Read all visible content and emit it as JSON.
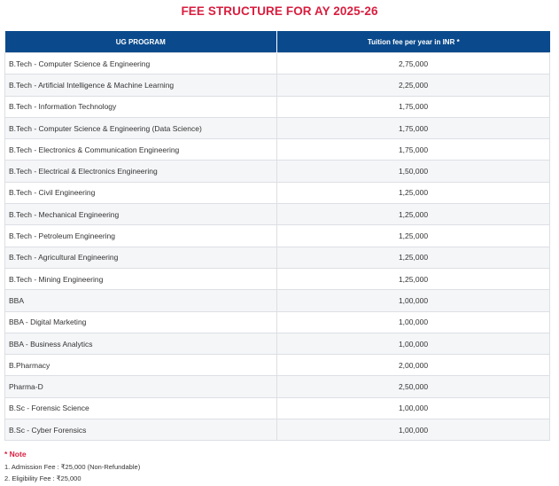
{
  "title": "FEE STRUCTURE FOR AY 2025-26",
  "table": {
    "headers": {
      "program": "UG PROGRAM",
      "fee": "Tuition fee per year in INR *"
    },
    "rows": [
      {
        "program": "B.Tech - Computer Science & Engineering",
        "fee": "2,75,000"
      },
      {
        "program": "B.Tech - Artificial Intelligence & Machine Learning",
        "fee": "2,25,000"
      },
      {
        "program": "B.Tech - Information Technology",
        "fee": "1,75,000"
      },
      {
        "program": "B.Tech - Computer Science & Engineering (Data Science)",
        "fee": "1,75,000"
      },
      {
        "program": "B.Tech - Electronics & Communication Engineering",
        "fee": "1,75,000"
      },
      {
        "program": "B.Tech - Electrical & Electronics Engineering",
        "fee": "1,50,000"
      },
      {
        "program": "B.Tech - Civil Engineering",
        "fee": "1,25,000"
      },
      {
        "program": "B.Tech - Mechanical Engineering",
        "fee": "1,25,000"
      },
      {
        "program": "B.Tech - Petroleum Engineering",
        "fee": "1,25,000"
      },
      {
        "program": "B.Tech - Agricultural Engineering",
        "fee": "1,25,000"
      },
      {
        "program": "B.Tech - Mining Engineering",
        "fee": "1,25,000"
      },
      {
        "program": "BBA",
        "fee": "1,00,000"
      },
      {
        "program": "BBA - Digital Marketing",
        "fee": "1,00,000"
      },
      {
        "program": "BBA - Business Analytics",
        "fee": "1,00,000"
      },
      {
        "program": "B.Pharmacy",
        "fee": "2,00,000"
      },
      {
        "program": "Pharma-D",
        "fee": "2,50,000"
      },
      {
        "program": "B.Sc - Forensic Science",
        "fee": "1,00,000"
      },
      {
        "program": "B.Sc - Cyber Forensics",
        "fee": "1,00,000"
      }
    ]
  },
  "note": {
    "heading": "* Note",
    "lines": [
      "1. Admission Fee : ₹25,000 (Non-Refundable)",
      "2. Eligibility Fee : ₹25,000"
    ]
  },
  "colors": {
    "title": "#d91e3f",
    "header_bg": "#0a4a8c",
    "note_heading": "#d91e3f"
  }
}
